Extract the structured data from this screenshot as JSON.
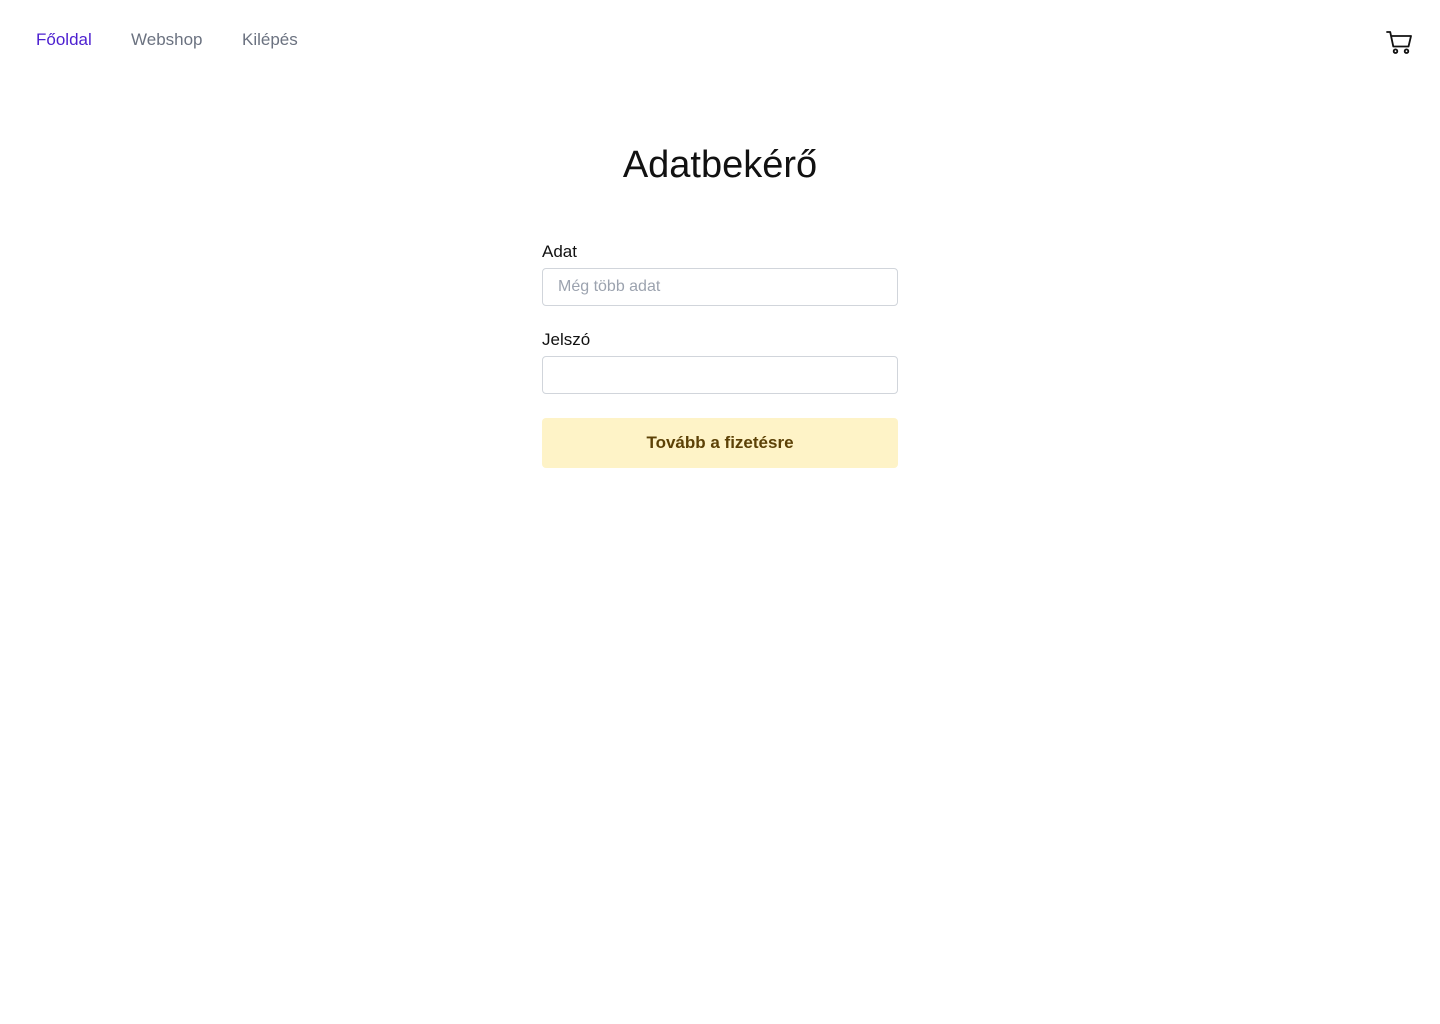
{
  "nav": {
    "items": [
      {
        "label": "Főoldal",
        "active": true
      },
      {
        "label": "Webshop",
        "active": false
      },
      {
        "label": "Kilépés",
        "active": false
      }
    ],
    "cart_icon": "shopping-cart-icon"
  },
  "main": {
    "title": "Adatbekérő",
    "fields": [
      {
        "label": "Adat",
        "value": "",
        "placeholder": "Még több adat"
      },
      {
        "label": "Jelszó",
        "value": "",
        "placeholder": ""
      }
    ],
    "submit_label": "Tovább a fizetésre"
  },
  "colors": {
    "active_nav": "#4c1fd0",
    "inactive_nav": "#6b7280",
    "button_bg": "#fef3c7",
    "button_text": "#5c4106"
  }
}
